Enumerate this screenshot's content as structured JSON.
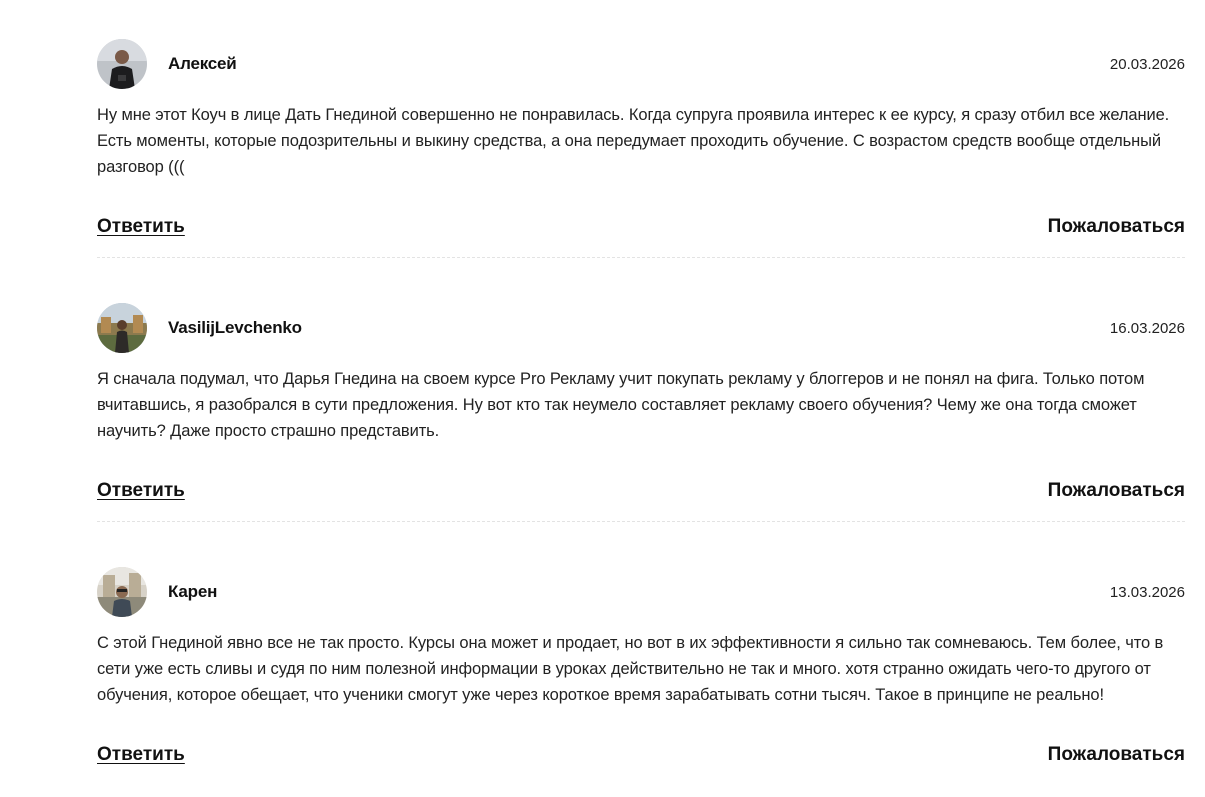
{
  "comments": [
    {
      "author": "Алексей",
      "date": "20.03.2026",
      "text": "Ну мне этот Коуч в лице Дать Гнединой совершенно не понравилась. Когда супруга проявила интерес к ее курсу, я сразу отбил все желание. Есть моменты, которые подозрительны и выкину средства, а она передумает проходить обучение. С возрастом средств вообще отдельный разговор (((",
      "reply_label": "Ответить",
      "report_label": "Пожаловаться"
    },
    {
      "author": "VasilijLevchenko",
      "date": "16.03.2026",
      "text": "Я сначала подумал, что Дарья Гнедина на своем курсе Pro Рекламу учит покупать рекламу у блоггеров и не понял на фига. Только потом вчитавшись, я разобрался в сути предложения. Ну вот кто так неумело составляет рекламу своего обучения? Чему же она тогда сможет научить? Даже просто страшно представить.",
      "reply_label": "Ответить",
      "report_label": "Пожаловаться"
    },
    {
      "author": "Карен",
      "date": "13.03.2026",
      "text": "С этой Гнединой явно все не так просто. Курсы она может и продает, но вот в их эффективности я сильно так сомневаюсь. Тем более, что в сети уже есть сливы и судя по ним полезной информации в уроках действительно не так и много. хотя странно ожидать чего-то другого от обучения, которое обещает, что ученики смогут уже через короткое время зарабатывать сотни тысяч. Такое в принципе не реально!",
      "reply_label": "Ответить",
      "report_label": "Пожаловаться"
    }
  ]
}
